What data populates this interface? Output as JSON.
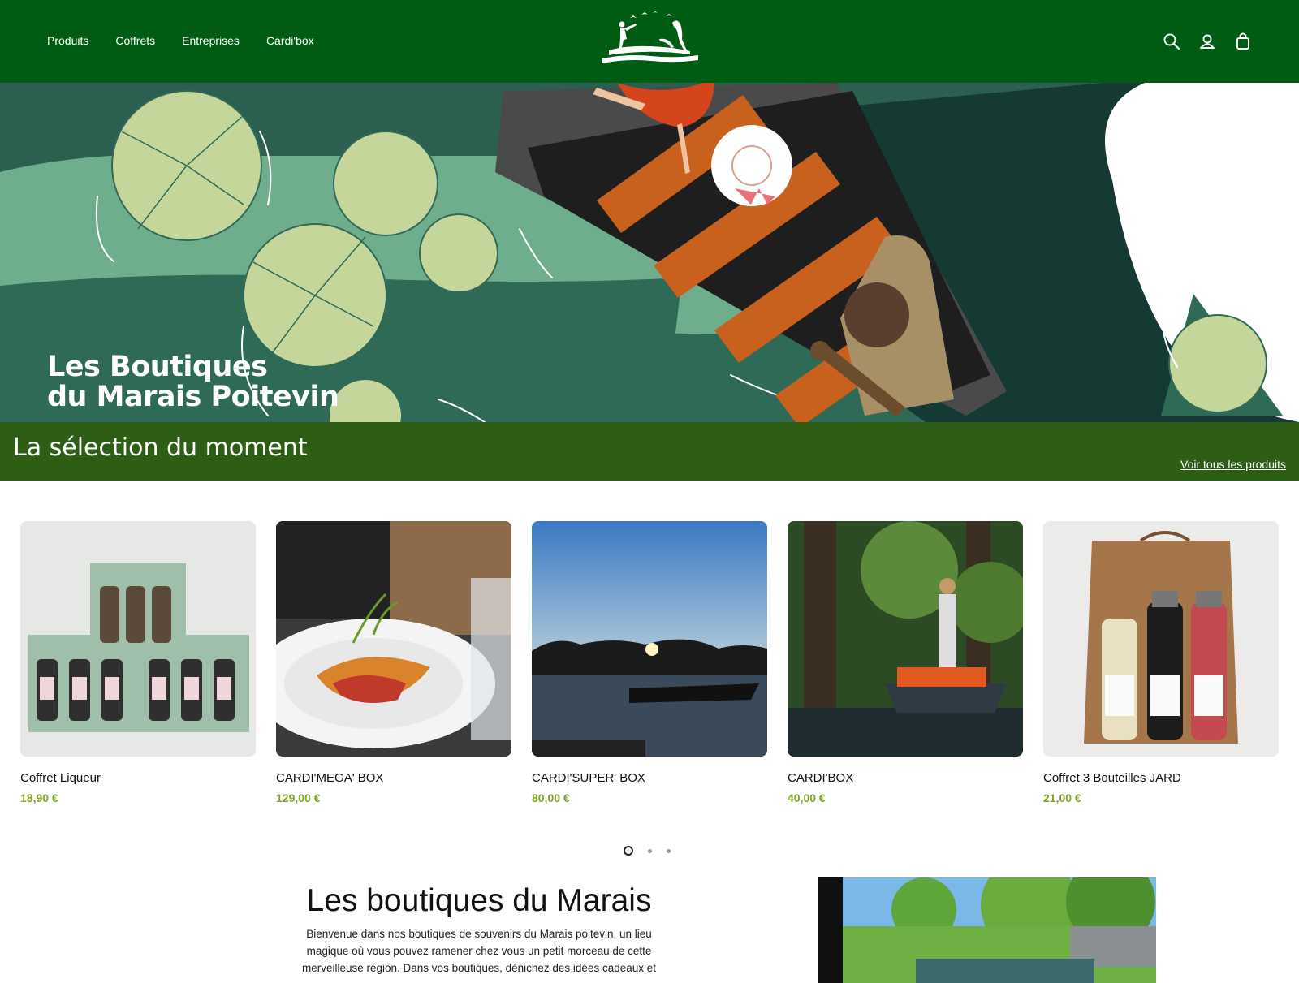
{
  "header": {
    "nav": [
      "Produits",
      "Coffrets",
      "Entreprises",
      "Cardi'box"
    ],
    "icons": [
      "search-icon",
      "account-icon",
      "cart-icon"
    ]
  },
  "hero": {
    "title_line1": "Les Boutiques",
    "title_line2": "du Marais Poitevin"
  },
  "selection": {
    "title": "La sélection du moment",
    "link": "Voir tous les produits"
  },
  "products": [
    {
      "name": "Coffret Liqueur",
      "price": "18,90 €"
    },
    {
      "name": "CARDI'MEGA' BOX",
      "price": "129,00 €"
    },
    {
      "name": "CARDI'SUPER' BOX",
      "price": "80,00 €"
    },
    {
      "name": "CARDI'BOX",
      "price": "40,00 €"
    },
    {
      "name": "Coffret 3 Bouteilles JARD",
      "price": "21,00 €"
    }
  ],
  "carousel": {
    "pages": 3,
    "active": 1
  },
  "about": {
    "title": "Les boutiques du Marais",
    "text": "Bienvenue dans nos boutiques de souvenirs du Marais poitevin, un lieu magique où vous pouvez ramener chez vous un petit morceau de cette merveilleuse région. Dans vos boutiques, dénichez des idées cadeaux et"
  },
  "colors": {
    "header": "#005c12",
    "band": "#2e5e16",
    "price": "#7fa52a"
  }
}
